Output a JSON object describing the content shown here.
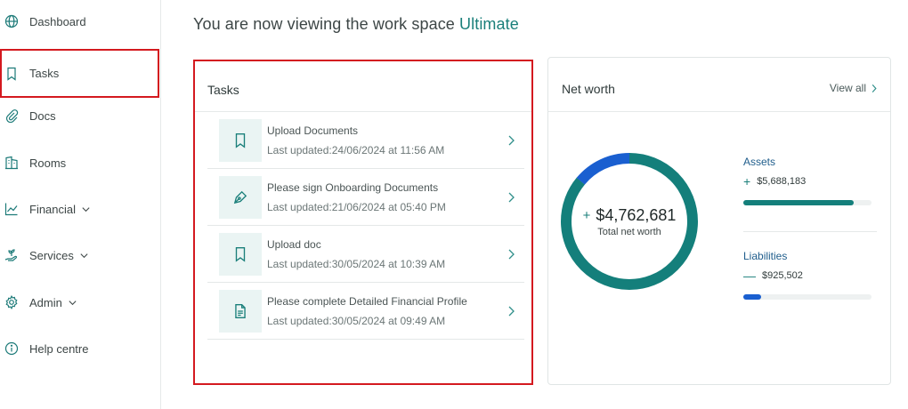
{
  "sidebar": {
    "items": [
      {
        "label": "Dashboard",
        "icon": "globe-icon"
      },
      {
        "label": "Tasks",
        "icon": "bookmark-icon",
        "selected": true
      },
      {
        "label": "Docs",
        "icon": "paperclip-icon"
      },
      {
        "label": "Rooms",
        "icon": "building-icon"
      },
      {
        "label": "Financial",
        "icon": "chart-line-icon",
        "dropdown": true
      },
      {
        "label": "Services",
        "icon": "hand-plant-icon",
        "dropdown": true
      },
      {
        "label": "Admin",
        "icon": "gear-icon",
        "dropdown": true
      },
      {
        "label": "Help centre",
        "icon": "info-icon"
      }
    ]
  },
  "header": {
    "prefix": "You are now viewing the work space",
    "workspace": "Ultimate"
  },
  "tasks_card": {
    "title": "Tasks",
    "items": [
      {
        "name": "Upload Documents",
        "updated": "Last updated:24/06/2024 at 11:56 AM",
        "icon": "bookmark-icon"
      },
      {
        "name": "Please sign Onboarding Documents",
        "updated": "Last updated:21/06/2024 at 05:40 PM",
        "icon": "pen-nib-icon"
      },
      {
        "name": "Upload doc",
        "updated": "Last updated:30/05/2024 at 10:39 AM",
        "icon": "bookmark-icon"
      },
      {
        "name": "Please complete Detailed Financial Profile",
        "updated": "Last updated:30/05/2024 at 09:49 AM",
        "icon": "document-icon"
      }
    ]
  },
  "net_worth": {
    "title": "Net worth",
    "view_all": "View all",
    "total": "$4,762,681",
    "total_sign": "+",
    "total_label": "Total net worth",
    "assets": {
      "label": "Assets",
      "sign": "+",
      "value": "$5,688,183",
      "fraction": 0.86
    },
    "liabilities": {
      "label": "Liabilities",
      "sign": "—",
      "value": "$925,502",
      "fraction": 0.14
    },
    "colors": {
      "assets": "#147f7b",
      "liabilities": "#1a5fd0",
      "accent": "#1a7f7a"
    }
  }
}
